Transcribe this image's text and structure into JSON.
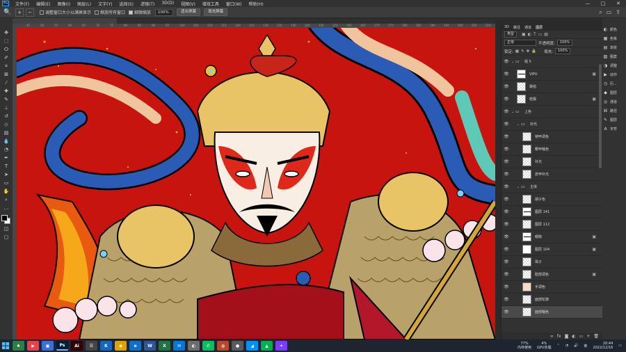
{
  "app": {
    "name": "Ps"
  },
  "menu": [
    "文件(F)",
    "编辑(E)",
    "图像(I)",
    "图层(L)",
    "文字(Y)",
    "选择(S)",
    "滤镜(T)",
    "3D(D)",
    "视图(V)",
    "增效工具",
    "窗口(W)",
    "帮助(H)"
  ],
  "window_controls": [
    "—",
    "□",
    "✕"
  ],
  "options_bar": {
    "checks": [
      "调整窗口大小以满屏显示",
      "缩放所有窗口",
      "细微缩放"
    ],
    "zoom_value": "100%",
    "buttons": [
      "适合屏幕",
      "填充屏幕"
    ]
  },
  "ruler": {
    "ticks": [
      "45",
      "50",
      "55",
      "60",
      "65",
      "70",
      "75",
      "80",
      "85",
      "90",
      "95",
      "100",
      "105",
      "110",
      "115",
      "120",
      "125",
      "130",
      "135",
      "140",
      "145",
      "150",
      "155",
      "160",
      "165",
      "170",
      "175",
      "180",
      "185",
      "190",
      "195",
      "200",
      "205",
      "210"
    ]
  },
  "layers_panel": {
    "tabs": [
      "3D",
      "路径",
      "通道",
      "图层"
    ],
    "filter_kind": "类型",
    "blend_mode": "正常",
    "opacity_label": "不透明度:",
    "opacity_value": "100%",
    "lock_label": "锁定:",
    "fill_label": "填充:",
    "fill_value": "100%",
    "layers": [
      {
        "name": "组 5",
        "kind": "group",
        "indent": 0,
        "locked": false
      },
      {
        "name": "VIPU",
        "kind": "line",
        "indent": 1,
        "locked": true
      },
      {
        "name": "飘毡",
        "kind": "layer",
        "indent": 1,
        "locked": false
      },
      {
        "name": "桂飘",
        "kind": "layer",
        "indent": 1,
        "locked": true
      },
      {
        "name": "上色",
        "kind": "group",
        "indent": 0,
        "locked": false
      },
      {
        "name": "补光",
        "kind": "group",
        "indent": 1,
        "locked": false
      },
      {
        "name": "铠甲调色",
        "kind": "layer",
        "indent": 2,
        "locked": false
      },
      {
        "name": "椰甲釉色",
        "kind": "layer",
        "indent": 2,
        "locked": false
      },
      {
        "name": "补光",
        "kind": "layer",
        "indent": 2,
        "locked": false
      },
      {
        "name": "皮甲补光",
        "kind": "layer",
        "indent": 2,
        "locked": false
      },
      {
        "name": "主体",
        "kind": "group",
        "indent": 1,
        "locked": false
      },
      {
        "name": "胡子色",
        "kind": "layer",
        "indent": 2,
        "locked": false
      },
      {
        "name": "图层 141",
        "kind": "line",
        "indent": 2,
        "locked": false
      },
      {
        "name": "图层 112",
        "kind": "layer",
        "indent": 2,
        "locked": false
      },
      {
        "name": "眼睛",
        "kind": "line",
        "indent": 2,
        "locked": true
      },
      {
        "name": "图层 104",
        "kind": "sketch",
        "indent": 2,
        "locked": true
      },
      {
        "name": "珠子",
        "kind": "layer",
        "indent": 2,
        "locked": false
      },
      {
        "name": "脸部调色",
        "kind": "layer",
        "indent": 2,
        "locked": true
      },
      {
        "name": "手调色",
        "kind": "skin",
        "indent": 2,
        "locked": false
      },
      {
        "name": "面部轮廓",
        "kind": "layer",
        "indent": 2,
        "locked": false
      },
      {
        "name": "面部釉色",
        "kind": "layer",
        "indent": 2,
        "locked": false
      }
    ],
    "selected_index": 20,
    "footer_icons": [
      "∞",
      "fx",
      "◙",
      "◐",
      "▭",
      "+",
      "🗑"
    ]
  },
  "dock": [
    {
      "icon": "◐",
      "label": "颜色"
    },
    {
      "icon": "▦",
      "label": "色板"
    },
    {
      "icon": "▤",
      "label": "渐变"
    },
    {
      "icon": "▧",
      "label": "图案"
    },
    {
      "icon": "◑",
      "label": "调整"
    },
    {
      "icon": "▶",
      "label": "动作"
    },
    {
      "icon": "◷",
      "label": "历..."
    },
    {
      "icon": "◆",
      "label": "图层"
    },
    {
      "icon": "◎",
      "label": "通道"
    },
    {
      "icon": "⌘",
      "label": "路径"
    },
    {
      "icon": "✎",
      "label": "图层"
    },
    {
      "icon": "A",
      "label": "字符"
    }
  ],
  "taskbar": {
    "apps": [
      {
        "label": "♠",
        "color": "#2d7d46"
      },
      {
        "label": "▶",
        "color": "#e9414b"
      },
      {
        "label": "▣",
        "color": "#3e6fd8"
      },
      {
        "label": "Ps",
        "color": "#001e36"
      },
      {
        "label": "Ai",
        "color": "#330000"
      },
      {
        "label": "☰",
        "color": "#444"
      },
      {
        "label": "K",
        "color": "#1565c0"
      },
      {
        "label": "◉",
        "color": "#e0a200"
      },
      {
        "label": "e",
        "color": "#0f6fc7"
      },
      {
        "label": "W",
        "color": "#2b579a"
      },
      {
        "label": "X",
        "color": "#217346"
      },
      {
        "label": "✉",
        "color": "#0078d4"
      },
      {
        "label": "◐",
        "color": "#6d6d6d"
      },
      {
        "label": "✆",
        "color": "#07c160"
      },
      {
        "label": "◍",
        "color": "#b84a2c"
      },
      {
        "label": "●",
        "color": "#5a5a5a"
      },
      {
        "label": "◢",
        "color": "#0090ff"
      },
      {
        "label": "▲",
        "color": "#00b050"
      },
      {
        "label": "✦",
        "color": "#7a3cff"
      }
    ],
    "memory_value": "77%",
    "memory_label": "内存使用",
    "gpu_value": "4%",
    "gpu_label": "GPU负载",
    "ime": "英",
    "time": "20:44",
    "date": "2022/12/16"
  },
  "colors": {
    "canvas_bg": "#c8140f",
    "ui_dark": "#323232",
    "accent": "#31a8ff"
  }
}
